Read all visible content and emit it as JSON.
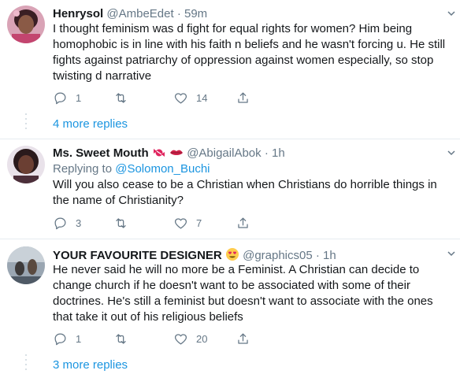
{
  "tweets": [
    {
      "name": "Henrysol",
      "handle": "@AmbeEdet",
      "sep": "·",
      "time": "59m",
      "lines": [
        "I thought feminism was d fight for equal rights for women? Him being",
        "homophobic is in line with his faith n beliefs and he wasn't forcing u. He still",
        "fights against patriarchy of oppression against women especially, so stop",
        "twisting d narrative"
      ],
      "replies": "1",
      "retweets": "",
      "likes": "14",
      "more_replies": "4 more replies"
    },
    {
      "name": "Ms. Sweet Mouth",
      "handle": "@AbigailAbok",
      "sep": "·",
      "time": "1h",
      "replying_prefix": "Replying to ",
      "replying_handle": "@Solomon_Buchi",
      "lines": [
        "Will you also cease to be a Christian when Christians do horrible things in",
        "the name of Christianity?"
      ],
      "replies": "3",
      "retweets": "",
      "likes": "7"
    },
    {
      "name": "YOUR FAVOURITE DESIGNER",
      "handle": "@graphics05",
      "sep": "·",
      "time": "1h",
      "lines": [
        "He never said he will no more be a Feminist. A Christian can decide to",
        "change church if he doesn't want to be associated with some of their",
        "doctrines. He's still a feminist but doesn't want to associate with the ones",
        "that take it out of his religious beliefs"
      ],
      "replies": "1",
      "retweets": "",
      "likes": "20",
      "more_replies": "3 more replies"
    }
  ],
  "icons": {
    "reply": "reply-icon",
    "retweet": "retweet-icon",
    "like": "heart-icon",
    "share": "share-icon",
    "caret": "chevron-down-icon"
  },
  "colors": {
    "link": "#1b95e0",
    "muted": "#657786",
    "divider": "#e6ecf0"
  }
}
